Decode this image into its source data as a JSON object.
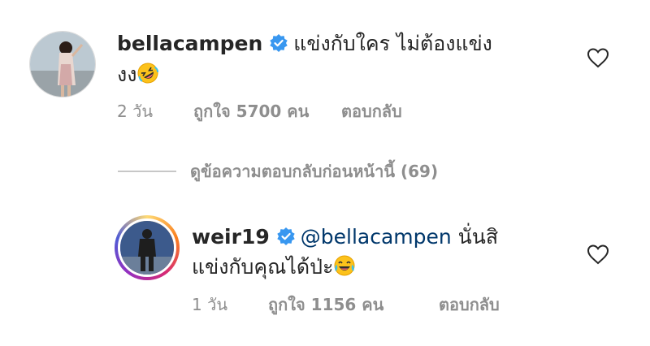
{
  "comment": {
    "username": "bellacampen",
    "text_line1": "แข่งกับใคร ไม่ต้องแข่ง",
    "text_line2": "งง",
    "emoji_icon": "rolling-on-floor-laughing-emoji",
    "time": "2 วัน",
    "likes": "ถูกใจ 5700 คน",
    "reply_label": "ตอบกลับ",
    "like_icon": "heart-outline-icon"
  },
  "view_replies": "ดูข้อความตอบกลับก่อนหน้านี้ (69)",
  "reply": {
    "username": "weir19",
    "mention": "@bellacampen",
    "text_after_mention": " นั่นสิ",
    "text_line2": "แข่งกับคุณได้ป่ะ",
    "emoji_icon": "tears-of-joy-emoji",
    "time": "1 วัน",
    "likes": "ถูกใจ 1156 คน",
    "reply_label": "ตอบกลับ",
    "like_icon": "heart-outline-icon"
  },
  "colors": {
    "verified_badge": "#3897f0",
    "mention": "#00376b",
    "muted_text": "#8e8e8e"
  }
}
